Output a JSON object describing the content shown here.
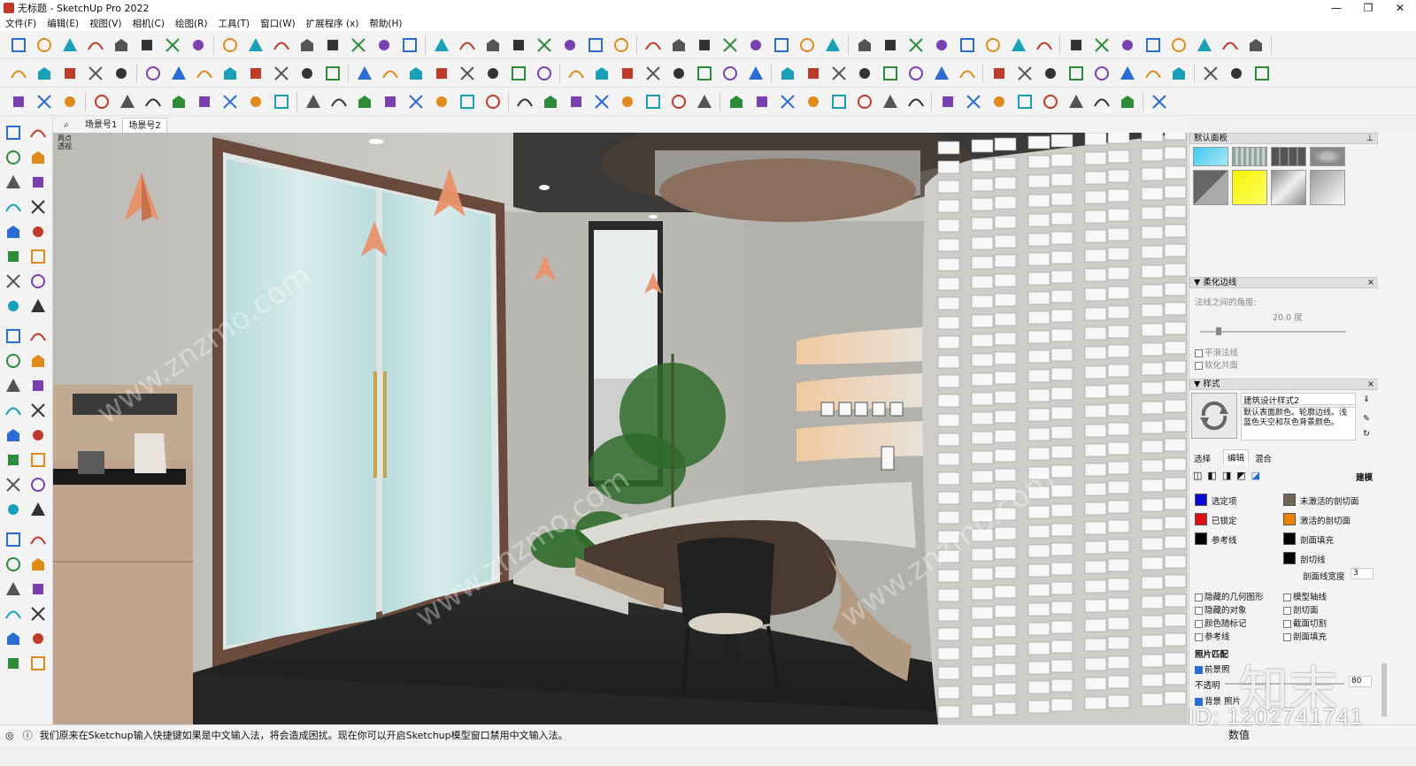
{
  "window": {
    "title": "无标题 - SketchUp Pro 2022",
    "controls": [
      "—",
      "❐",
      "✕"
    ]
  },
  "menu": [
    "文件(F)",
    "编辑(E)",
    "视图(V)",
    "相机(C)",
    "绘图(R)",
    "工具(T)",
    "窗口(W)",
    "扩展程序 (x)",
    "帮助(H)"
  ],
  "scene_tabs": {
    "search_glyph": "⌕",
    "tabs": [
      "场景号1",
      "场景号2"
    ],
    "active_index": 1
  },
  "viewport": {
    "perspective_label": [
      "两点",
      "透视"
    ]
  },
  "panel": {
    "tray_title": "默认面板",
    "soften": {
      "title": "柔化边线",
      "angle_label": "法线之间的角度:",
      "angle_value": "20.0  度",
      "smooth_normals": "平滑法线",
      "soften_coplanar": "软化共面"
    },
    "styles": {
      "title": "样式",
      "style_name": "建筑设计样式2",
      "description": "默认表面颜色。轮廓边线。浅蓝色天空和灰色背景颜色。",
      "tabs": [
        "选择",
        "编辑",
        "混合"
      ],
      "active_tab": 1,
      "model_label": "建模",
      "colors_left": [
        {
          "label": "选定项",
          "color": "#0b0bd8"
        },
        {
          "label": "已锁定",
          "color": "#e01010"
        },
        {
          "label": "参考线",
          "color": "#000000"
        }
      ],
      "colors_right": [
        {
          "label": "未激活的剖切面",
          "color": "#6e6654"
        },
        {
          "label": "激活的剖切面",
          "color": "#f08000"
        },
        {
          "label": "剖面填充",
          "color": "#000000"
        },
        {
          "label": "剖切线",
          "color": "#000000"
        }
      ],
      "section_width_label": "剖面线宽度",
      "section_width_value": "3",
      "checks_left": [
        "隐藏的几何图形",
        "隐藏的对象",
        "颜色随标记",
        "参考线"
      ],
      "checks_right": [
        "模型轴线",
        "剖切面",
        "截面切割",
        "剖面填充"
      ],
      "photo_match_label": "照片匹配",
      "foreground_label": "前景照",
      "opacity_label": "不透明",
      "opacity_value": "80",
      "background_label": "背景 照片"
    }
  },
  "status": {
    "message": "我们原来在Sketchup输入快捷键如果是中文输入法，将会造成困扰。现在你可以开启Sketchup模型窗口禁用中文输入法。",
    "value_label": "数值"
  },
  "watermarks": {
    "id_text": "ID: 1202741741",
    "logo_text": "知末"
  },
  "colors": {
    "accent_blue": "#1f6fd1",
    "toolbar_bg": "#f3f3f3"
  }
}
